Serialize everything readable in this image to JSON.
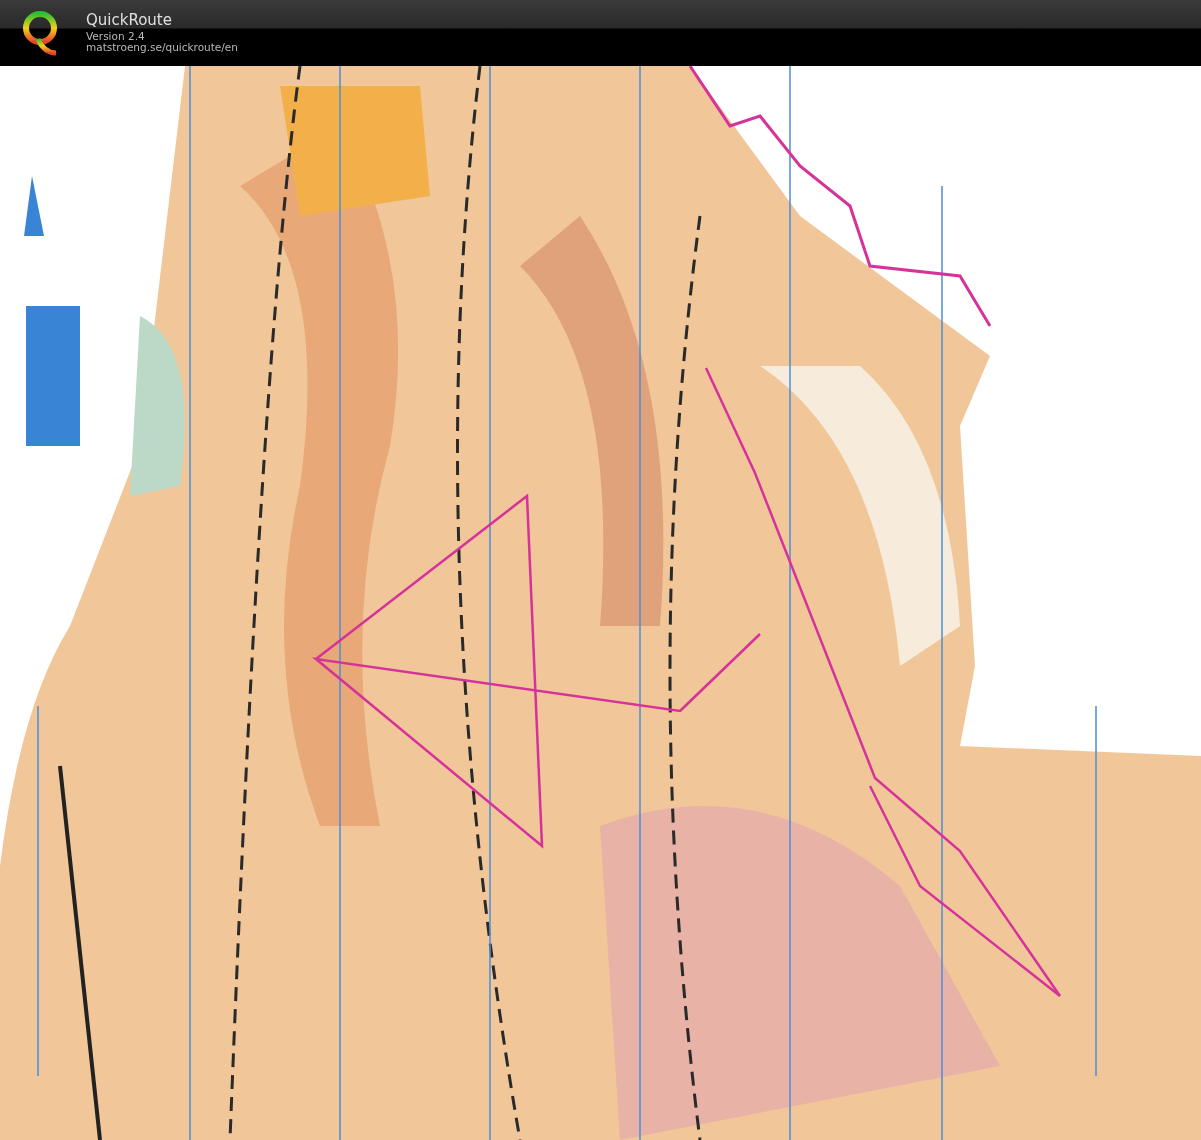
{
  "header": {
    "title": "QuickRoute",
    "version": "Version 2.4",
    "url": "matstroeng.se/quickroute/en"
  }
}
